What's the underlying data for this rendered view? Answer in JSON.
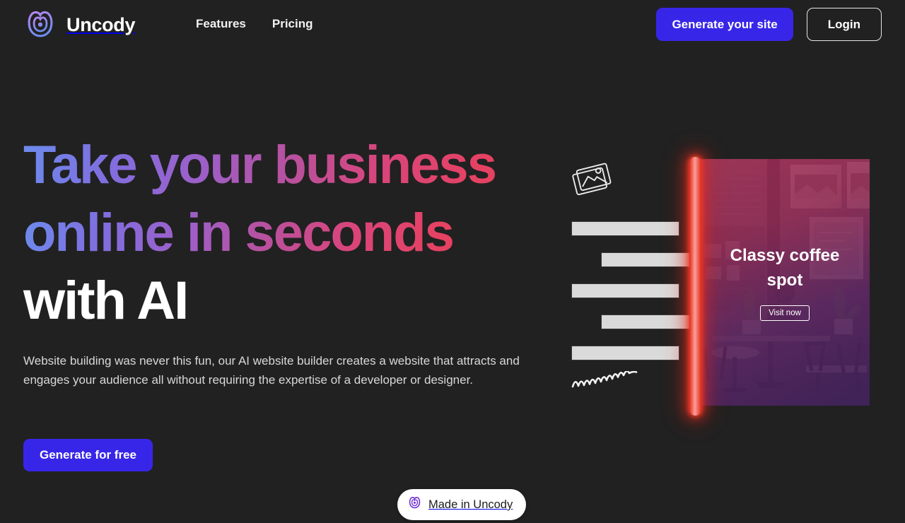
{
  "brand": {
    "name": "Uncody",
    "logo_icon": "uncody-logo-icon",
    "logo_gradient_from": "#b07ff0",
    "logo_gradient_to": "#6f8cf0"
  },
  "header": {
    "nav": [
      {
        "label": "Features",
        "name": "nav-link-features"
      },
      {
        "label": "Pricing",
        "name": "nav-link-pricing"
      }
    ],
    "primary_cta": "Generate your site",
    "secondary_cta": "Login",
    "primary_color": "#3826e8"
  },
  "hero": {
    "headline_gradient_line1": "Take your business",
    "headline_gradient_line2": "online in seconds",
    "headline_plain_line3": "with AI",
    "headline_gradient_from": "#6c8ced",
    "headline_gradient_to": "#e8415e",
    "body": "Website building was never this fun, our AI website builder creates a website that attracts and engages your audience all without requiring the expertise of a developer or designer.",
    "cta": "Generate for free"
  },
  "illustration": {
    "photo_icon": "photo-stack-icon",
    "squiggle_icon": "squiggle-line-icon",
    "neon_bar_color": "#e8392a",
    "placeholder_bar_count": 5,
    "card": {
      "title": "Classy coffee spot",
      "cta": "Visit now",
      "photo_alt": "coffee-shop-interior"
    }
  },
  "badge": {
    "label": "Made in Uncody",
    "icon": "uncody-logo-icon"
  }
}
